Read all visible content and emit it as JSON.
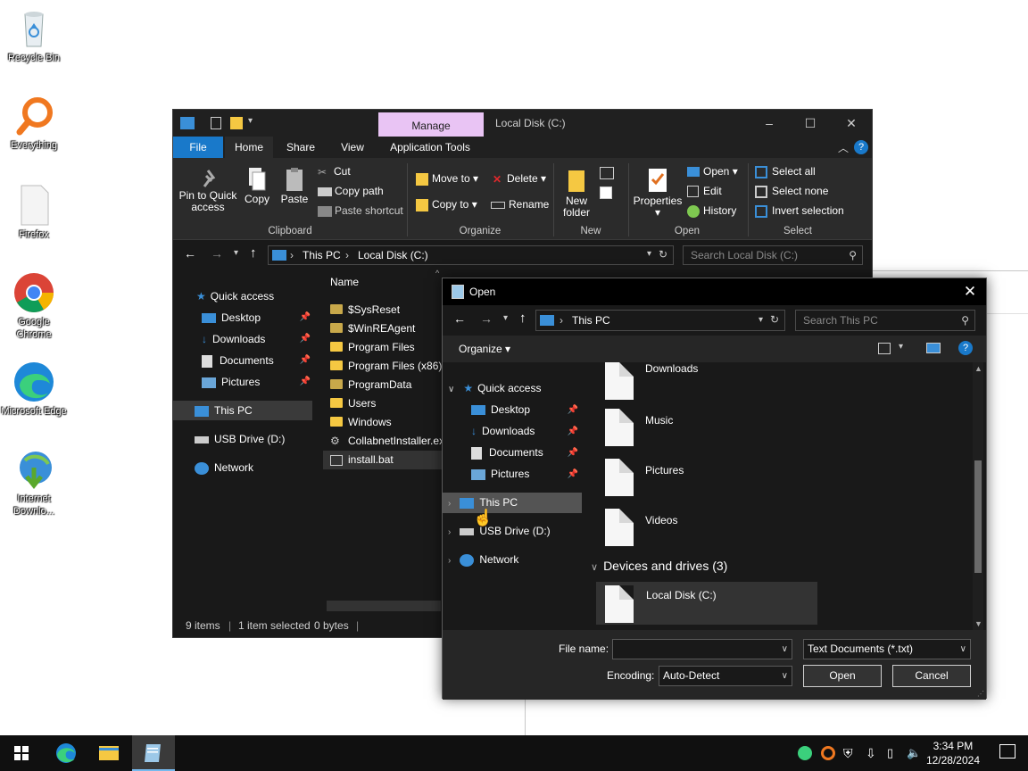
{
  "desktop": {
    "icons": [
      {
        "label": "Recycle Bin"
      },
      {
        "label": "Everything"
      },
      {
        "label": "Firefox"
      },
      {
        "label": "Google Chrome"
      },
      {
        "label": "Microsoft Edge"
      },
      {
        "label": "Internet Downlo..."
      }
    ]
  },
  "explorer": {
    "title": "Local Disk (C:)",
    "manage_tab": "Manage",
    "tabs": [
      "File",
      "Home",
      "Share",
      "View",
      "Application Tools"
    ],
    "ribbon": {
      "clipboard": {
        "label": "Clipboard",
        "pin": "Pin to Quick access",
        "copy": "Copy",
        "paste": "Paste",
        "cut": "Cut",
        "copy_path": "Copy path",
        "paste_shortcut": "Paste shortcut"
      },
      "organize": {
        "label": "Organize",
        "move_to": "Move to",
        "copy_to": "Copy to",
        "delete": "Delete",
        "rename": "Rename"
      },
      "new": {
        "label": "New",
        "new_folder": "New folder"
      },
      "open": {
        "label": "Open",
        "properties": "Properties",
        "open": "Open",
        "edit": "Edit",
        "history": "History"
      },
      "select": {
        "label": "Select",
        "select_all": "Select all",
        "select_none": "Select none",
        "invert": "Invert selection"
      }
    },
    "address": {
      "crumb1": "This PC",
      "crumb2": "Local Disk (C:)"
    },
    "search_placeholder": "Search Local Disk (C:)",
    "nav": [
      {
        "label": "Quick access",
        "pinned": false
      },
      {
        "label": "Desktop",
        "pinned": true
      },
      {
        "label": "Downloads",
        "pinned": true
      },
      {
        "label": "Documents",
        "pinned": true
      },
      {
        "label": "Pictures",
        "pinned": true
      },
      {
        "label": "This PC",
        "pinned": false
      },
      {
        "label": "USB Drive (D:)",
        "pinned": false
      },
      {
        "label": "Network",
        "pinned": false
      }
    ],
    "column_name": "Name",
    "files": [
      "$SysReset",
      "$WinREAgent",
      "Program Files",
      "Program Files (x86)",
      "ProgramData",
      "Users",
      "Windows",
      "CollabnetInstaller.exe",
      "install.bat"
    ],
    "status": {
      "items": "9 items",
      "selected": "1 item selected",
      "size": "0 bytes"
    }
  },
  "dialog": {
    "title": "Open",
    "address": "This PC",
    "search_placeholder": "Search This PC",
    "organize": "Organize",
    "tree": [
      {
        "label": "Quick access"
      },
      {
        "label": "Desktop"
      },
      {
        "label": "Downloads"
      },
      {
        "label": "Documents"
      },
      {
        "label": "Pictures"
      },
      {
        "label": "This PC"
      },
      {
        "label": "USB Drive (D:)"
      },
      {
        "label": "Network"
      }
    ],
    "folders": [
      "Downloads",
      "Music",
      "Pictures",
      "Videos"
    ],
    "section_header": "Devices and drives (3)",
    "drive": "Local Disk (C:)",
    "file_name_label": "File name:",
    "file_name_value": "",
    "file_type": "Text Documents (*.txt)",
    "encoding_label": "Encoding:",
    "encoding_value": "Auto-Detect",
    "open_btn": "Open",
    "cancel_btn": "Cancel"
  },
  "taskbar": {
    "time": "3:34 PM",
    "date": "12/28/2024"
  }
}
